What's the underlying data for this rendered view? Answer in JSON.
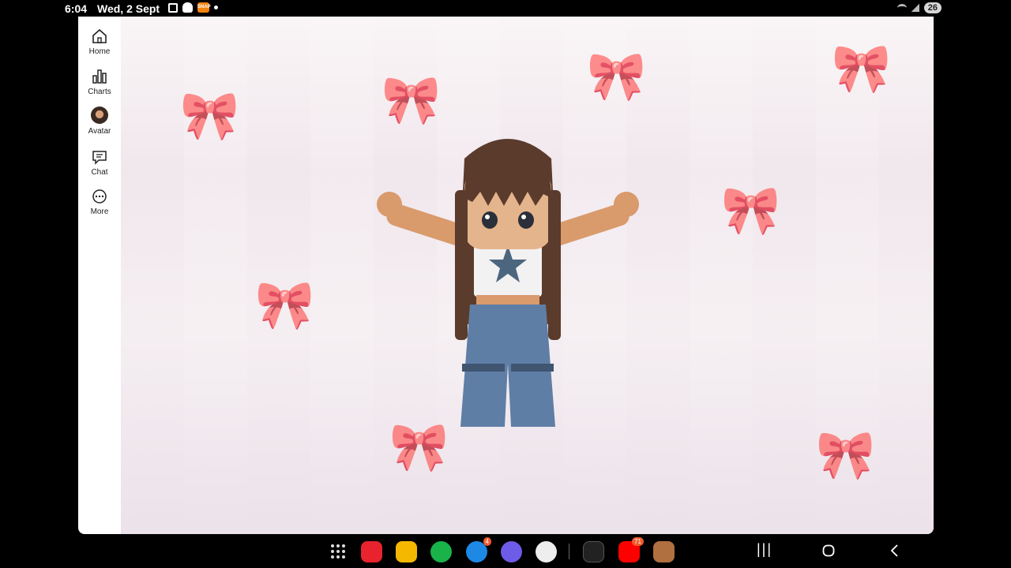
{
  "status": {
    "time": "6:04",
    "date": "Wed, 2 Sept",
    "battery": "26",
    "notification_icons": [
      "fullscreen-icon",
      "snapchat-icon",
      "app-icon",
      "dot-icon"
    ],
    "app_icon_text": "SNAP"
  },
  "sidebar": {
    "items": [
      {
        "label": "Home",
        "icon": "home-icon"
      },
      {
        "label": "Charts",
        "icon": "charts-icon"
      },
      {
        "label": "Avatar",
        "icon": "avatar-icon"
      },
      {
        "label": "Chat",
        "icon": "chat-icon"
      },
      {
        "label": "More",
        "icon": "more-icon"
      }
    ]
  },
  "taskbar": {
    "apps": [
      {
        "name": "apps-grid"
      },
      {
        "name": "flipboard",
        "color": "#e8232d"
      },
      {
        "name": "files",
        "color": "#f5b800"
      },
      {
        "name": "phone",
        "color": "#19b34a"
      },
      {
        "name": "messages",
        "color": "#1e88e5",
        "badge": "4"
      },
      {
        "name": "internet",
        "color": "#6c5ce7"
      },
      {
        "name": "camera",
        "color": "#eeeeee"
      },
      {
        "name": "game-app",
        "color": "#222222"
      },
      {
        "name": "youtube",
        "color": "#ff0000",
        "badge": "71"
      },
      {
        "name": "game-app-2",
        "color": "#b07040"
      }
    ]
  },
  "colors": {
    "accent_pink": "#e8b9cd",
    "sidebar_bg": "#ffffff",
    "scene_bg": "#f3ecf0"
  }
}
